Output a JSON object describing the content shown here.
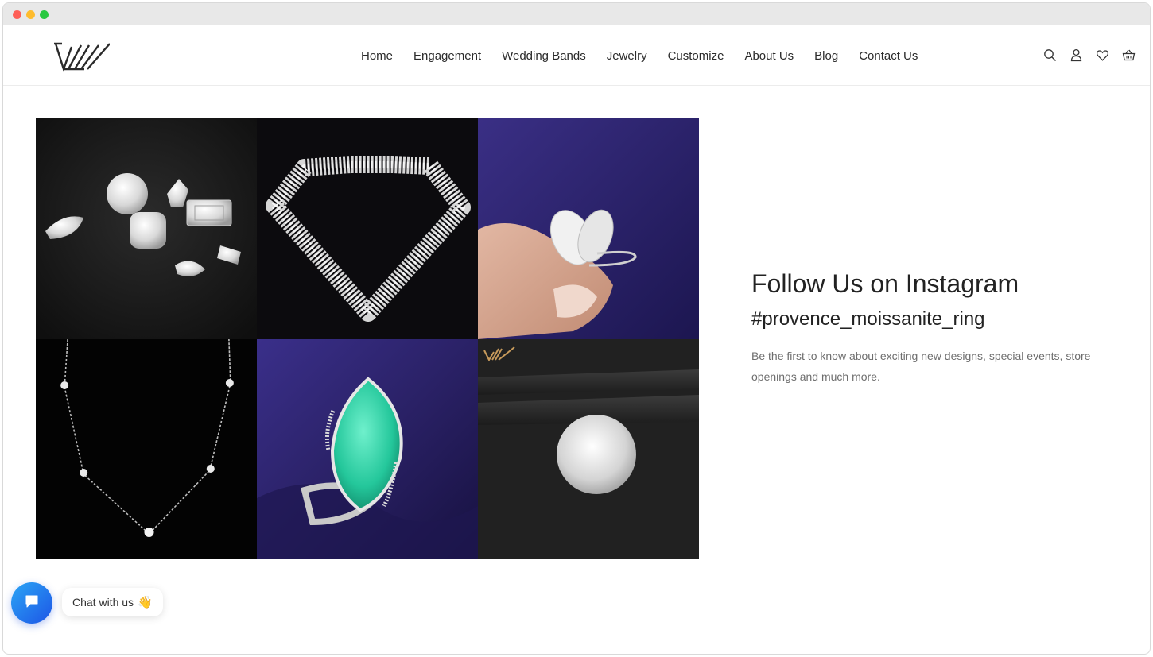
{
  "window": {
    "controls": [
      "close",
      "minimize",
      "maximize"
    ]
  },
  "header": {
    "logo_icon": "brand-monogram-logo",
    "nav": [
      {
        "label": "Home"
      },
      {
        "label": "Engagement"
      },
      {
        "label": "Wedding Bands"
      },
      {
        "label": "Jewelry"
      },
      {
        "label": "Customize"
      },
      {
        "label": "About Us"
      },
      {
        "label": "Blog"
      },
      {
        "label": "Contact Us"
      }
    ],
    "icons": [
      "search-icon",
      "account-icon",
      "wishlist-heart-icon",
      "cart-basket-icon"
    ]
  },
  "gallery": {
    "tiles": [
      {
        "subject": "loose diamonds of various cuts on black sand"
      },
      {
        "subject": "diamond-shaped arrangement of small stones"
      },
      {
        "subject": "pear-cut toi et moi ring held in fingers on purple cloth"
      },
      {
        "subject": "diamond station necklace on black"
      },
      {
        "subject": "marquise green emerald ring on purple satin"
      },
      {
        "subject": "round diamond held in tweezers"
      }
    ]
  },
  "instagram": {
    "title": "Follow Us on Instagram",
    "hashtag": "#provence_moissanite_ring",
    "description": "Be the first to know about exciting new designs, special events, store openings and much more."
  },
  "chat": {
    "label": "Chat with us",
    "emoji": "👋",
    "icon": "chat-bubble-icon"
  },
  "colors": {
    "accent": "#1d55e6",
    "text": "#222222",
    "muted": "#6e6e6e",
    "tile_purple": "#2c2466"
  }
}
